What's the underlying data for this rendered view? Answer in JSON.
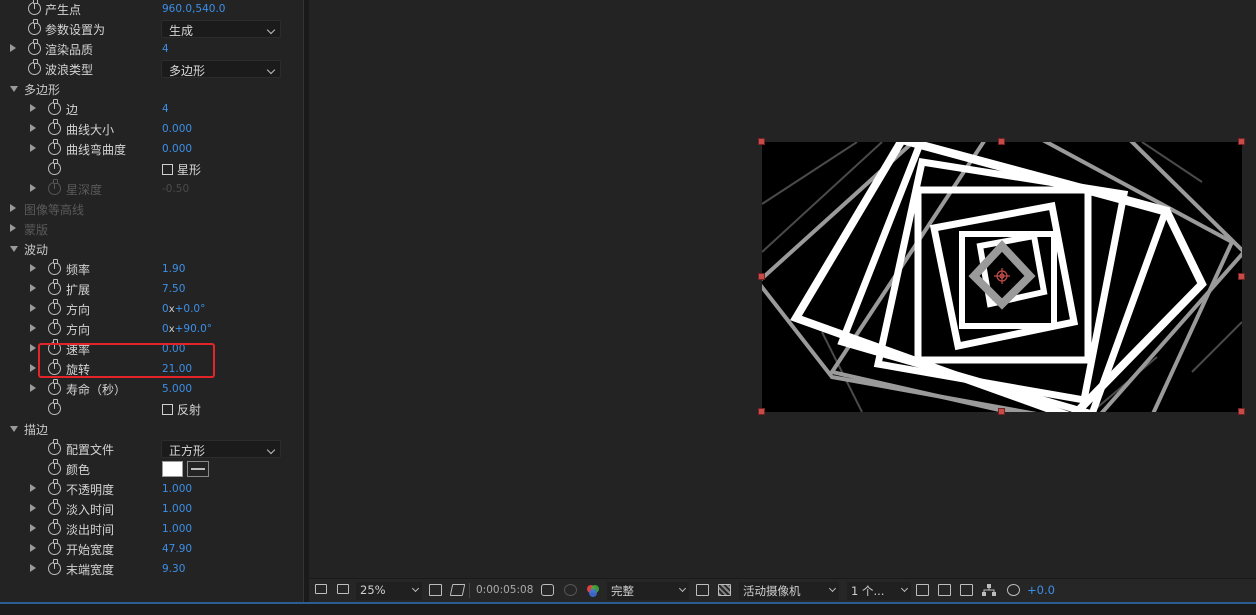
{
  "effect_panel": {
    "rows": [
      {
        "indent": 1,
        "twirl": "none",
        "stopwatch": true,
        "label": "产生点",
        "value": "960.0,540.0",
        "type": "point",
        "partial": true
      },
      {
        "indent": 1,
        "twirl": "none",
        "stopwatch": true,
        "label": "参数设置为",
        "type": "dropdown",
        "value": "生成"
      },
      {
        "indent": 1,
        "twirl": "closed",
        "stopwatch": true,
        "label": "渲染品质",
        "type": "number",
        "value": "4"
      },
      {
        "indent": 1,
        "twirl": "none",
        "stopwatch": true,
        "label": "波浪类型",
        "type": "dropdown",
        "value": "多边形"
      },
      {
        "indent": 0,
        "twirl": "open",
        "stopwatch": false,
        "label": "多边形",
        "type": "group"
      },
      {
        "indent": 2,
        "twirl": "closed",
        "stopwatch": true,
        "label": "边",
        "type": "number",
        "value": "4"
      },
      {
        "indent": 2,
        "twirl": "closed",
        "stopwatch": true,
        "label": "曲线大小",
        "type": "number",
        "value": "0.000"
      },
      {
        "indent": 2,
        "twirl": "closed",
        "stopwatch": true,
        "label": "曲线弯曲度",
        "type": "number",
        "value": "0.000"
      },
      {
        "indent": 2,
        "twirl": "none",
        "stopwatch": true,
        "label": "",
        "type": "checkbox",
        "value": "星形",
        "checked": false
      },
      {
        "indent": 2,
        "twirl": "closed",
        "stopwatch": true,
        "label": "星深度",
        "type": "number",
        "value": "-0.50",
        "disabled": true
      },
      {
        "indent": 0,
        "twirl": "closed",
        "stopwatch": false,
        "label": "图像等高线",
        "type": "group",
        "disabled": true
      },
      {
        "indent": 0,
        "twirl": "closed",
        "stopwatch": false,
        "label": "蒙版",
        "type": "group",
        "disabled": true
      },
      {
        "indent": 0,
        "twirl": "open",
        "stopwatch": false,
        "label": "波动",
        "type": "group"
      },
      {
        "indent": 2,
        "twirl": "closed",
        "stopwatch": true,
        "label": "频率",
        "type": "number",
        "value": "1.90"
      },
      {
        "indent": 2,
        "twirl": "closed",
        "stopwatch": true,
        "label": "扩展",
        "type": "number",
        "value": "7.50"
      },
      {
        "indent": 2,
        "twirl": "closed",
        "stopwatch": true,
        "label": "方向",
        "type": "angle",
        "rev": "0",
        "deg": "+0.0°"
      },
      {
        "indent": 2,
        "twirl": "closed",
        "stopwatch": true,
        "label": "方向",
        "type": "angle",
        "rev": "0",
        "deg": "+90.0°"
      },
      {
        "indent": 2,
        "twirl": "closed",
        "stopwatch": true,
        "label": "速率",
        "type": "number",
        "value": "0.00",
        "partial": true
      },
      {
        "indent": 2,
        "twirl": "closed",
        "stopwatch": true,
        "label": "旋转",
        "type": "number",
        "value": "21.00"
      },
      {
        "indent": 2,
        "twirl": "closed",
        "stopwatch": true,
        "label": "寿命（秒）",
        "type": "number",
        "value": "5.000",
        "partial": true
      },
      {
        "indent": 2,
        "twirl": "none",
        "stopwatch": true,
        "label": "",
        "type": "checkbox",
        "value": "反射",
        "checked": false
      },
      {
        "indent": 0,
        "twirl": "open",
        "stopwatch": false,
        "label": "描边",
        "type": "group"
      },
      {
        "indent": 2,
        "twirl": "none",
        "stopwatch": true,
        "label": "配置文件",
        "type": "dropdown",
        "value": "正方形"
      },
      {
        "indent": 2,
        "twirl": "none",
        "stopwatch": true,
        "label": "颜色",
        "type": "color",
        "value": "#ffffff"
      },
      {
        "indent": 2,
        "twirl": "closed",
        "stopwatch": true,
        "label": "不透明度",
        "type": "number",
        "value": "1.000"
      },
      {
        "indent": 2,
        "twirl": "closed",
        "stopwatch": true,
        "label": "淡入时间",
        "type": "number",
        "value": "1.000"
      },
      {
        "indent": 2,
        "twirl": "closed",
        "stopwatch": true,
        "label": "淡出时间",
        "type": "number",
        "value": "1.000"
      },
      {
        "indent": 2,
        "twirl": "closed",
        "stopwatch": true,
        "label": "开始宽度",
        "type": "number",
        "value": "47.90"
      },
      {
        "indent": 2,
        "twirl": "closed",
        "stopwatch": true,
        "label": "末端宽度",
        "type": "number",
        "value": "9.30"
      }
    ]
  },
  "toolbar": {
    "zoom": "25%",
    "timecode": "0:00:05:08",
    "resolution": "完整",
    "camera": "活动摄像机",
    "views": "1 个...",
    "exposure": "+0.0"
  },
  "colors": {
    "accent_value": "#3c8fe6",
    "highlight_box": "#e3252a",
    "handle": "#c34d4d"
  },
  "icons": [
    "stopwatch-icon",
    "twirl-arrow-icon",
    "camera-snapshot-icon",
    "color-channels-icon",
    "exposure-reset-icon"
  ]
}
